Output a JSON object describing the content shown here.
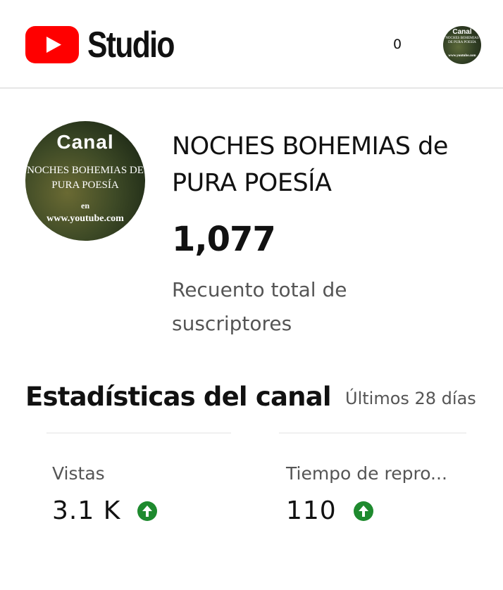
{
  "header": {
    "brand_label": "Studio",
    "notification_count": "0",
    "account_avatar": {
      "line1": "Canal",
      "line2": "NOCHES BOHEMIAS DE PURA POESÍA",
      "line3": "www.youtube.com"
    }
  },
  "channel": {
    "avatar": {
      "line1": "Canal",
      "line2a": "NOCHES BOHEMIAS DE",
      "line2b": "PURA POESÍA",
      "line3": "en",
      "line4": "www.youtube.com"
    },
    "name": "NOCHES BOHEMIAS de PURA POESÍA",
    "subscriber_count": "1,077",
    "subscriber_label": "Recuento total de suscriptores"
  },
  "stats": {
    "title": "Estadísticas del canal",
    "period": "Últimos 28 días",
    "metrics": [
      {
        "label": "Vistas",
        "value": "3.1 K",
        "trend": "up"
      },
      {
        "label": "Tiempo de repro...",
        "value": "110",
        "trend": "up"
      }
    ]
  },
  "colors": {
    "brand_red": "#ff0000",
    "trend_up_green": "#1e8a2e",
    "divider": "#e6e6e6"
  },
  "icons": {
    "logo": "youtube-play-icon",
    "trend": "arrow-up-icon"
  }
}
